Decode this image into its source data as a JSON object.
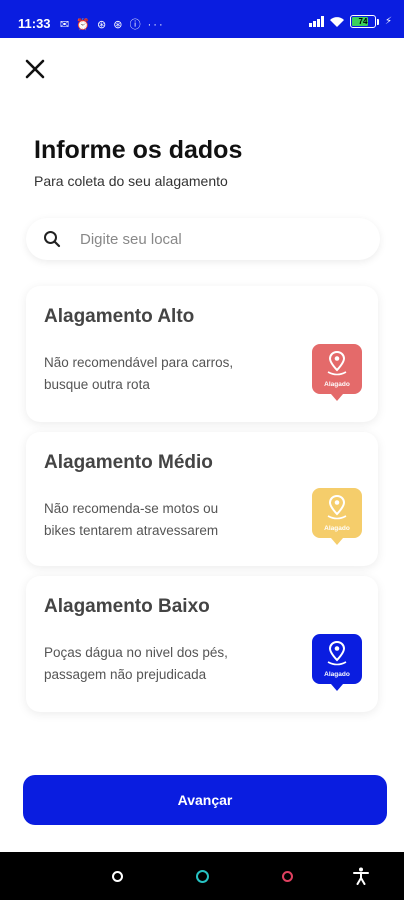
{
  "status": {
    "time": "11:33",
    "left_icons": "✉ ⏰ ⊛ ⊛ ⓘ  ···",
    "battery": "74",
    "battery_level": 0.74
  },
  "header": {
    "title": "Informe os dados",
    "subtitle": "Para coleta do seu alagamento"
  },
  "search": {
    "placeholder": "Digite seu local",
    "value": ""
  },
  "options": [
    {
      "title": "Alagamento Alto",
      "description": "Não recomendável para carros, busque outra rota",
      "badge_label": "Alagado",
      "color": "#e46a6a"
    },
    {
      "title": "Alagamento Médio",
      "description": "Não recomenda-se motos ou bikes tentarem atravessarem",
      "badge_label": "Alagado",
      "color": "#f5cd6b"
    },
    {
      "title": "Alagamento Baixo",
      "description": "Poças dágua no nivel dos pés, passagem não prejudicada",
      "badge_label": "Alagado",
      "color": "#0a1de0"
    }
  ],
  "actions": {
    "submit_label": "Avançar"
  },
  "colors": {
    "primary": "#0a1de0"
  }
}
